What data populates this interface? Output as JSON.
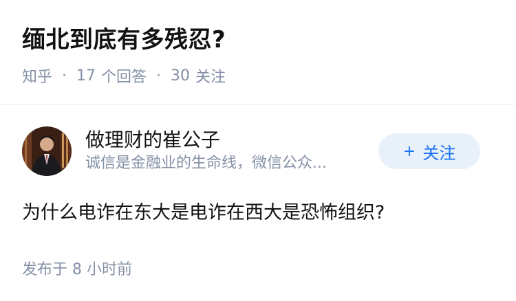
{
  "question": {
    "title": "缅北到底有多残忍?",
    "source": "知乎",
    "answers_count": "17",
    "answers_label": "个回答",
    "follows_count": "30",
    "follows_label": "关注"
  },
  "answer": {
    "author_name": "做理财的崔公子",
    "author_bio": "诚信是金融业的生命线，微信公众...",
    "follow_plus": "+",
    "follow_label": "关注",
    "content": "为什么电诈在东大是电诈在西大是恐怖组织?",
    "published": "发布于  8 小时前"
  },
  "colors": {
    "accent": "#1772f6",
    "button_bg": "#e8f0fa",
    "meta_gray": "#8590a6"
  }
}
